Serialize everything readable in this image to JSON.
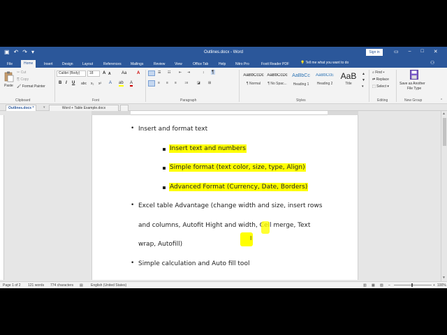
{
  "window": {
    "title": "Outlines.docx - Word",
    "signin": "Sign in",
    "min_icon": "minimize-icon",
    "restore_icon": "restore-icon",
    "close_icon": "close-icon"
  },
  "qat": {
    "save_icon": "save-icon",
    "undo_icon": "undo-icon",
    "redo_icon": "redo-icon",
    "customize_icon": "customize-icon"
  },
  "tabs": [
    "File",
    "Home",
    "Insert",
    "Design",
    "Layout",
    "References",
    "Mailings",
    "Review",
    "View",
    "Office Tab",
    "Help",
    "Nitro Pro",
    "Foxit Reader PDF"
  ],
  "tell_me": "Tell me what you want to do",
  "ribbon": {
    "clipboard": {
      "paste": "Paste",
      "cut": "Cut",
      "copy": "Copy",
      "format_painter": "Format Painter",
      "label": "Clipboard"
    },
    "font": {
      "name": "Calibri (Body)",
      "size": "18",
      "label": "Font",
      "bold": "B",
      "italic": "I",
      "underline": "U",
      "grow": "A",
      "shrink": "A",
      "case": "Aa",
      "clear": "A"
    },
    "paragraph": {
      "label": "Paragraph",
      "show_marks": "¶"
    },
    "styles": {
      "label": "Styles",
      "items": [
        {
          "sample": "AaBbCcDc",
          "name": "¶ Normal"
        },
        {
          "sample": "AaBbCcDc",
          "name": "¶ No Spac..."
        },
        {
          "sample": "AaBbCc",
          "name": "Heading 1"
        },
        {
          "sample": "AaBbCcE",
          "name": "Heading 2"
        },
        {
          "sample": "AaB",
          "name": "Title"
        }
      ]
    },
    "editing": {
      "find": "Find",
      "replace": "Replace",
      "select": "Select",
      "label": "Editing"
    },
    "newgroup": {
      "save_line1": "Save as Another",
      "save_line2": "File Type",
      "label": "New Group"
    }
  },
  "doc_tabs": [
    "Outlines.docx *",
    "Word + Table Example.docx"
  ],
  "document": {
    "bullets": [
      {
        "text": "Insert and format text"
      },
      {
        "text": "Excel table Advantage (change width and size, insert rows"
      },
      {
        "text": "Simple calculation and Auto fill tool"
      }
    ],
    "continuation": [
      "and columns, Autofit Hight and width, Cell merge, Text",
      "wrap, Autofill)"
    ],
    "sub_items": [
      "Insert text and numbers",
      "Simple format (text color, size, type, Align)",
      "Advanced Format (Currency, Date, Borders)"
    ]
  },
  "status": {
    "page": "Page 1 of 2",
    "words": "121 words",
    "chars": "774 characters",
    "language": "English (United States)",
    "zoom": "100%"
  },
  "colors": {
    "word_blue": "#2b579a",
    "highlight": "#ffff00"
  }
}
